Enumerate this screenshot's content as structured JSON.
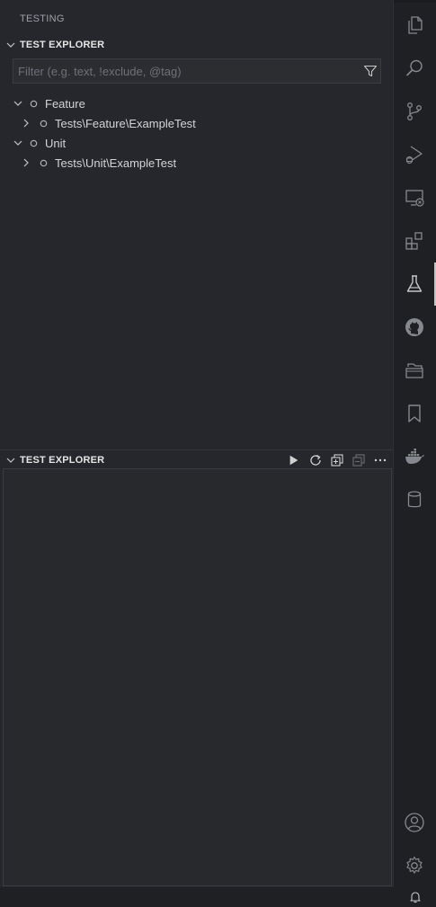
{
  "panel": {
    "title": "TESTING"
  },
  "sections": {
    "explorer": {
      "title": "TEST EXPLORER"
    },
    "results": {
      "title": "TEST EXPLORER"
    }
  },
  "filter": {
    "placeholder": "Filter (e.g. text, !exclude, @tag)",
    "value": ""
  },
  "tree": [
    {
      "label": "Feature",
      "expanded": true,
      "level": 0
    },
    {
      "label": "Tests\\Feature\\ExampleTest",
      "expanded": false,
      "level": 1
    },
    {
      "label": "Unit",
      "expanded": true,
      "level": 0
    },
    {
      "label": "Tests\\Unit\\ExampleTest",
      "expanded": false,
      "level": 1
    }
  ],
  "results_actions": [
    "run-all-icon",
    "refresh-icon",
    "expand-all-icon",
    "collapse-all-icon",
    "more-actions-icon"
  ],
  "activity_bar": {
    "items": [
      "explorer-icon",
      "search-icon",
      "source-control-icon",
      "run-debug-icon",
      "remote-explorer-icon",
      "extensions-icon",
      "testing-icon",
      "github-icon",
      "project-manager-icon",
      "bookmarks-icon",
      "docker-icon",
      "database-icon"
    ],
    "active": "testing-icon",
    "bottom": [
      "accounts-icon",
      "manage-icon"
    ]
  },
  "colors": {
    "sidebar_bg": "#25272c",
    "activity_bg": "#1f2023",
    "icon": "#85888e",
    "active_icon": "#c5c5c5"
  }
}
